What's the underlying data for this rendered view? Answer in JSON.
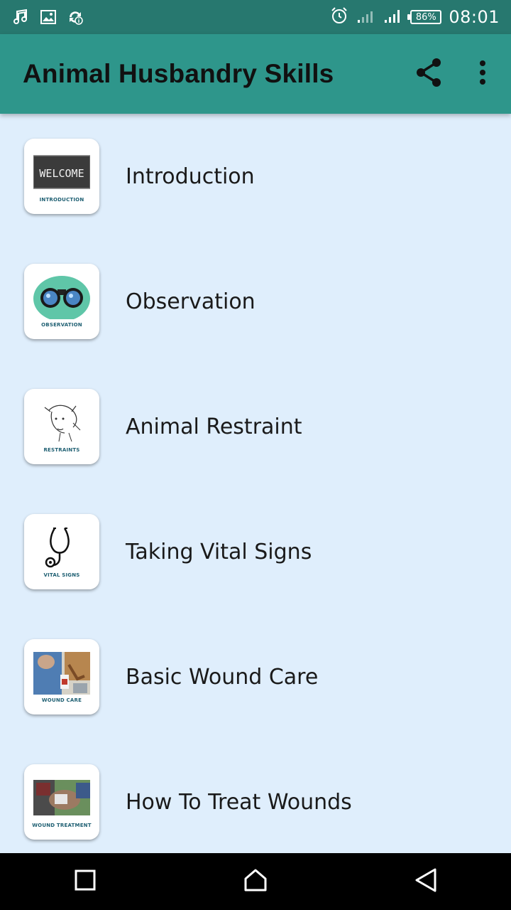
{
  "status_bar": {
    "battery": "86%",
    "time": "08:01"
  },
  "app_bar": {
    "title": "Animal Husbandry Skills",
    "share_icon": "share-icon",
    "menu_icon": "more-vert-icon"
  },
  "items": [
    {
      "label": "Introduction",
      "caption": "INTRODUCTION",
      "image_text": "WELCOME"
    },
    {
      "label": "Observation",
      "caption": "OBSERVATION"
    },
    {
      "label": "Animal Restraint",
      "caption": "RESTRAINTS"
    },
    {
      "label": "Taking Vital Signs",
      "caption": "VITAL SIGNS"
    },
    {
      "label": "Basic Wound Care",
      "caption": "WOUND CARE"
    },
    {
      "label": "How To Treat Wounds",
      "caption": "WOUND TREATMENT"
    }
  ],
  "colors": {
    "status_bar": "#27786f",
    "app_bar": "#2e968b",
    "background": "#dfeefc"
  }
}
